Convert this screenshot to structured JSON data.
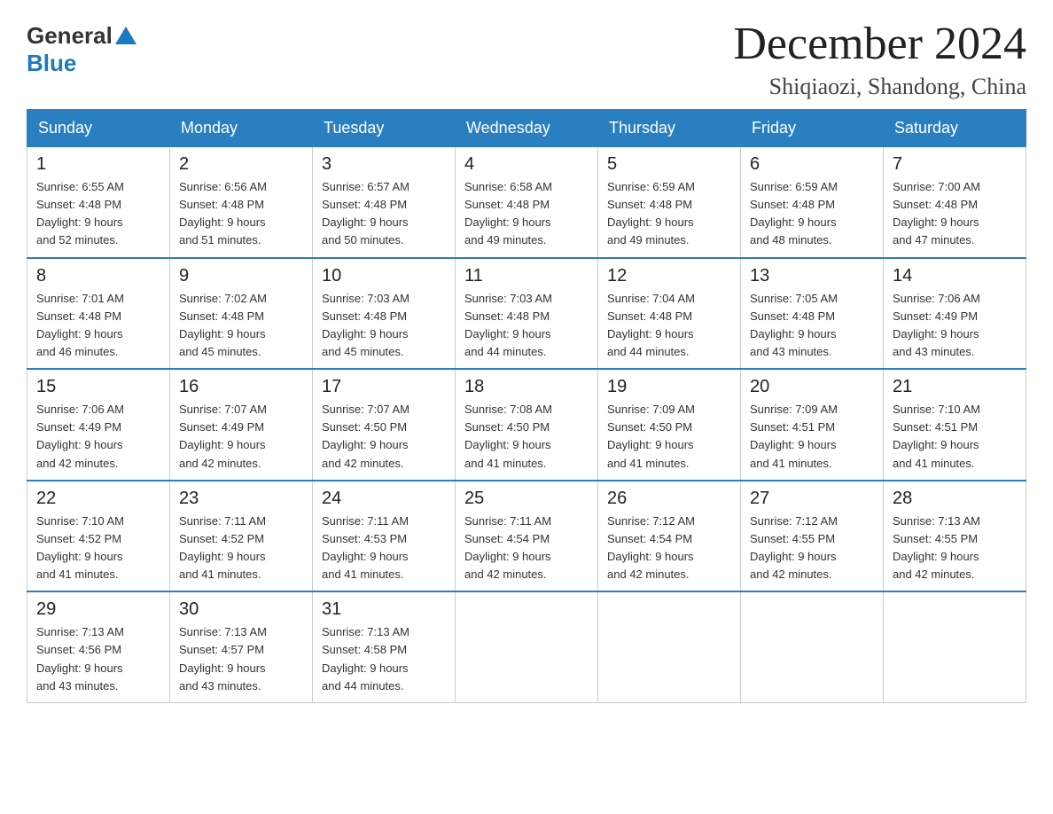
{
  "header": {
    "logo_general": "General",
    "logo_blue": "Blue",
    "title": "December 2024",
    "subtitle": "Shiqiaozi, Shandong, China"
  },
  "days_of_week": [
    "Sunday",
    "Monday",
    "Tuesday",
    "Wednesday",
    "Thursday",
    "Friday",
    "Saturday"
  ],
  "weeks": [
    [
      {
        "day": "1",
        "sunrise": "6:55 AM",
        "sunset": "4:48 PM",
        "daylight": "9 hours and 52 minutes."
      },
      {
        "day": "2",
        "sunrise": "6:56 AM",
        "sunset": "4:48 PM",
        "daylight": "9 hours and 51 minutes."
      },
      {
        "day": "3",
        "sunrise": "6:57 AM",
        "sunset": "4:48 PM",
        "daylight": "9 hours and 50 minutes."
      },
      {
        "day": "4",
        "sunrise": "6:58 AM",
        "sunset": "4:48 PM",
        "daylight": "9 hours and 49 minutes."
      },
      {
        "day": "5",
        "sunrise": "6:59 AM",
        "sunset": "4:48 PM",
        "daylight": "9 hours and 49 minutes."
      },
      {
        "day": "6",
        "sunrise": "6:59 AM",
        "sunset": "4:48 PM",
        "daylight": "9 hours and 48 minutes."
      },
      {
        "day": "7",
        "sunrise": "7:00 AM",
        "sunset": "4:48 PM",
        "daylight": "9 hours and 47 minutes."
      }
    ],
    [
      {
        "day": "8",
        "sunrise": "7:01 AM",
        "sunset": "4:48 PM",
        "daylight": "9 hours and 46 minutes."
      },
      {
        "day": "9",
        "sunrise": "7:02 AM",
        "sunset": "4:48 PM",
        "daylight": "9 hours and 45 minutes."
      },
      {
        "day": "10",
        "sunrise": "7:03 AM",
        "sunset": "4:48 PM",
        "daylight": "9 hours and 45 minutes."
      },
      {
        "day": "11",
        "sunrise": "7:03 AM",
        "sunset": "4:48 PM",
        "daylight": "9 hours and 44 minutes."
      },
      {
        "day": "12",
        "sunrise": "7:04 AM",
        "sunset": "4:48 PM",
        "daylight": "9 hours and 44 minutes."
      },
      {
        "day": "13",
        "sunrise": "7:05 AM",
        "sunset": "4:48 PM",
        "daylight": "9 hours and 43 minutes."
      },
      {
        "day": "14",
        "sunrise": "7:06 AM",
        "sunset": "4:49 PM",
        "daylight": "9 hours and 43 minutes."
      }
    ],
    [
      {
        "day": "15",
        "sunrise": "7:06 AM",
        "sunset": "4:49 PM",
        "daylight": "9 hours and 42 minutes."
      },
      {
        "day": "16",
        "sunrise": "7:07 AM",
        "sunset": "4:49 PM",
        "daylight": "9 hours and 42 minutes."
      },
      {
        "day": "17",
        "sunrise": "7:07 AM",
        "sunset": "4:50 PM",
        "daylight": "9 hours and 42 minutes."
      },
      {
        "day": "18",
        "sunrise": "7:08 AM",
        "sunset": "4:50 PM",
        "daylight": "9 hours and 41 minutes."
      },
      {
        "day": "19",
        "sunrise": "7:09 AM",
        "sunset": "4:50 PM",
        "daylight": "9 hours and 41 minutes."
      },
      {
        "day": "20",
        "sunrise": "7:09 AM",
        "sunset": "4:51 PM",
        "daylight": "9 hours and 41 minutes."
      },
      {
        "day": "21",
        "sunrise": "7:10 AM",
        "sunset": "4:51 PM",
        "daylight": "9 hours and 41 minutes."
      }
    ],
    [
      {
        "day": "22",
        "sunrise": "7:10 AM",
        "sunset": "4:52 PM",
        "daylight": "9 hours and 41 minutes."
      },
      {
        "day": "23",
        "sunrise": "7:11 AM",
        "sunset": "4:52 PM",
        "daylight": "9 hours and 41 minutes."
      },
      {
        "day": "24",
        "sunrise": "7:11 AM",
        "sunset": "4:53 PM",
        "daylight": "9 hours and 41 minutes."
      },
      {
        "day": "25",
        "sunrise": "7:11 AM",
        "sunset": "4:54 PM",
        "daylight": "9 hours and 42 minutes."
      },
      {
        "day": "26",
        "sunrise": "7:12 AM",
        "sunset": "4:54 PM",
        "daylight": "9 hours and 42 minutes."
      },
      {
        "day": "27",
        "sunrise": "7:12 AM",
        "sunset": "4:55 PM",
        "daylight": "9 hours and 42 minutes."
      },
      {
        "day": "28",
        "sunrise": "7:13 AM",
        "sunset": "4:55 PM",
        "daylight": "9 hours and 42 minutes."
      }
    ],
    [
      {
        "day": "29",
        "sunrise": "7:13 AM",
        "sunset": "4:56 PM",
        "daylight": "9 hours and 43 minutes."
      },
      {
        "day": "30",
        "sunrise": "7:13 AM",
        "sunset": "4:57 PM",
        "daylight": "9 hours and 43 minutes."
      },
      {
        "day": "31",
        "sunrise": "7:13 AM",
        "sunset": "4:58 PM",
        "daylight": "9 hours and 44 minutes."
      },
      null,
      null,
      null,
      null
    ]
  ]
}
